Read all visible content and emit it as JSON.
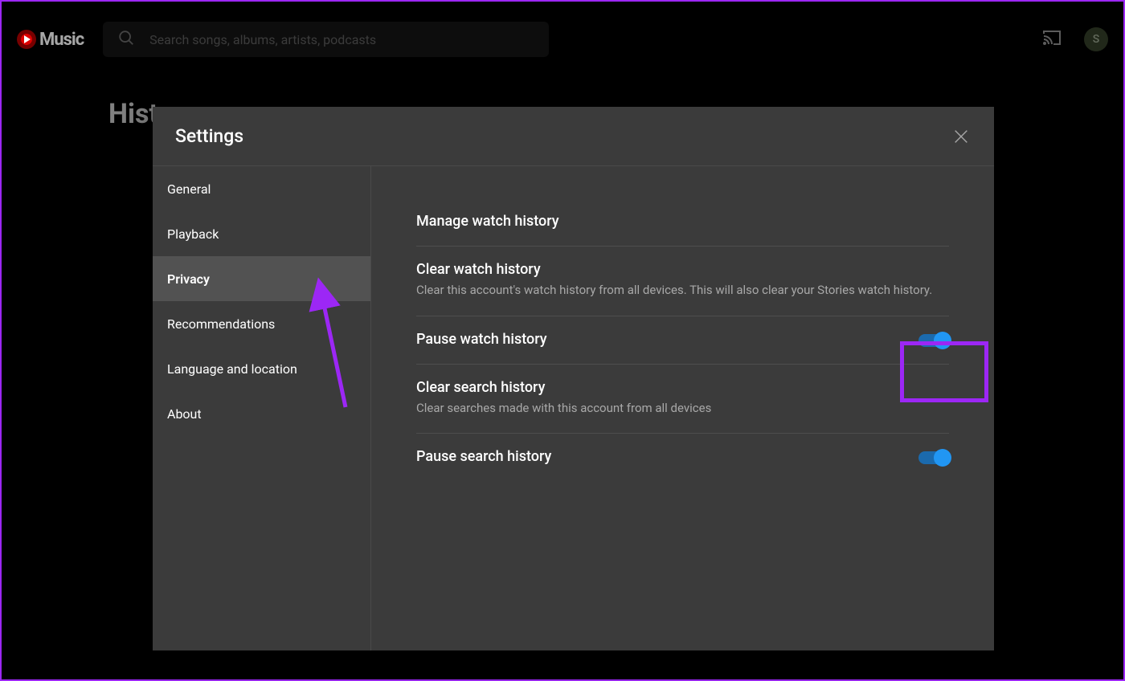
{
  "brand": {
    "name": "Music"
  },
  "search": {
    "placeholder": "Search songs, albums, artists, podcasts"
  },
  "avatar_initial": "S",
  "page_heading": "Hist",
  "dialog": {
    "title": "Settings",
    "sidebar": [
      {
        "label": "General",
        "active": false
      },
      {
        "label": "Playback",
        "active": false
      },
      {
        "label": "Privacy",
        "active": true
      },
      {
        "label": "Recommendations",
        "active": false
      },
      {
        "label": "Language and location",
        "active": false
      },
      {
        "label": "About",
        "active": false
      }
    ],
    "settings": [
      {
        "title": "Manage watch history",
        "desc": "",
        "toggle": null
      },
      {
        "title": "Clear watch history",
        "desc": "Clear this account's watch history from all devices. This will also clear your Stories watch history.",
        "toggle": null
      },
      {
        "title": "Pause watch history",
        "desc": "",
        "toggle": true
      },
      {
        "title": "Clear search history",
        "desc": "Clear searches made with this account from all devices",
        "toggle": null
      },
      {
        "title": "Pause search history",
        "desc": "",
        "toggle": true
      }
    ]
  },
  "annotation": {
    "highlight_color": "#9c27f5",
    "box_target": "pause-watch-history-toggle",
    "arrow_target": "sidebar-item-privacy"
  }
}
